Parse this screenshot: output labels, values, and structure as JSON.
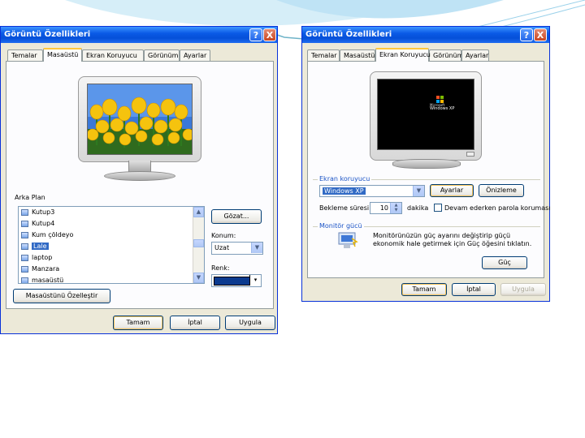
{
  "left_window": {
    "title": "Görüntü Özellikleri",
    "help_glyph": "?",
    "close_glyph": "X",
    "tabs": [
      "Temalar",
      "Masaüstü",
      "Ekran Koruyucu",
      "Görünüm",
      "Ayarlar"
    ],
    "active_tab": "Masaüstü",
    "background_label": "Arka Plan",
    "wallpapers": [
      "Kutup3",
      "Kutup4",
      "Kum çöldeyo",
      "Lale",
      "laptop",
      "Manzara",
      "masaüstü"
    ],
    "selected_wallpaper": "Lale",
    "browse_button": "Gözat...",
    "position_label": "Konum:",
    "position_value": "Uzat",
    "color_label": "Renk:",
    "color_value": "#0b3a8f",
    "customize_button": "Masaüstünü Özelleştir",
    "ok_button": "Tamam",
    "cancel_button": "İptal",
    "apply_button": "Uygula"
  },
  "right_window": {
    "title": "Görüntü Özellikleri",
    "help_glyph": "?",
    "close_glyph": "X",
    "tabs": [
      "Temalar",
      "Masaüstü",
      "Ekran Koruyucu",
      "Görünüm",
      "Ayarlar"
    ],
    "active_tab": "Ekran Koruyucu",
    "screensaver_group": "Ekran koruyucu",
    "screensaver_value": "Windows XP",
    "settings_button": "Ayarlar",
    "preview_button": "Önizleme",
    "wait_label": "Bekleme süresi:",
    "wait_value": "10",
    "minutes_label": "dakika",
    "resume_password_label": "Devam ederken parola koruması",
    "power_group": "Monitör gücü",
    "power_text": "Monitörünüzün güç ayarını değiştirip güçü ekonomik hale getirmek için Güç öğesini tıklatın.",
    "power_button": "Güç",
    "ok_button": "Tamam",
    "cancel_button": "İptal",
    "apply_button": "Uygula",
    "screen_logo_line1": "Microsoft",
    "screen_logo_line2": "Windows XP"
  },
  "colors": {
    "titlebar": "#0a5ae6",
    "window_face": "#ece9d8",
    "selection": "#316ac5",
    "tab_highlight": "#ffc73c"
  }
}
